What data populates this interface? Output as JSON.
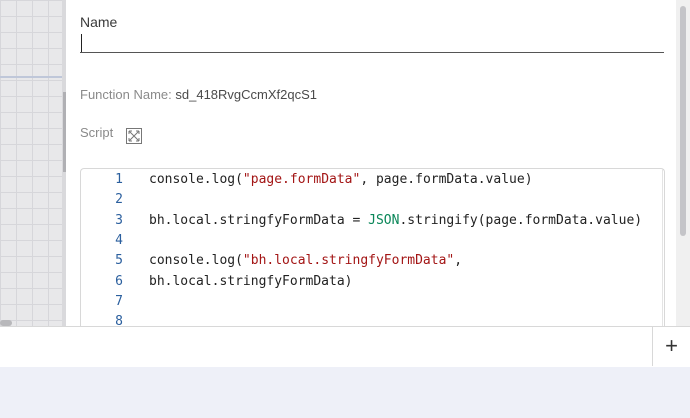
{
  "form": {
    "name_label": "Name",
    "name_value": "",
    "function_name_label": "Function Name:",
    "function_name_value": "sd_418RvgCcmXf2qcS1",
    "script_label": "Script"
  },
  "icons": {
    "expand": "expand-icon",
    "add": "plus-icon"
  },
  "editor": {
    "lines": [
      {
        "no": "1",
        "parts": [
          [
            "plain",
            "console.log("
          ],
          [
            "str",
            "\"page.formData\""
          ],
          [
            "plain",
            ", page.formData.value)"
          ]
        ]
      },
      {
        "no": "2",
        "parts": []
      },
      {
        "no": "3",
        "parts": [
          [
            "plain",
            "bh.local.stringfyFormData = "
          ],
          [
            "kw",
            "JSON"
          ],
          [
            "plain",
            ".stringify(page.formData.value)"
          ]
        ]
      },
      {
        "no": "4",
        "parts": []
      },
      {
        "no": "5",
        "parts": [
          [
            "plain",
            "console.log("
          ],
          [
            "str",
            "\"bh.local.stringfyFormData\""
          ],
          [
            "plain",
            ","
          ]
        ]
      },
      {
        "no": "6",
        "parts": [
          [
            "plain",
            "bh.local.stringfyFormData)"
          ]
        ]
      },
      {
        "no": "7",
        "parts": []
      },
      {
        "no": "8",
        "parts": []
      }
    ]
  },
  "bottom": {
    "add_label": "+"
  },
  "colors": {
    "string": "#a31515",
    "keyword": "#098658",
    "line_number": "#2b5f9e"
  }
}
